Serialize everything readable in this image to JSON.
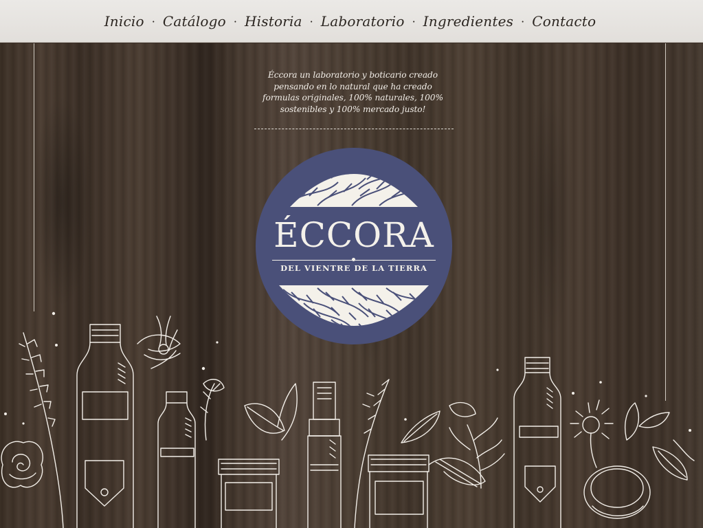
{
  "nav": {
    "items": [
      "Inicio",
      "Catálogo",
      "Historia",
      "Laboratorio",
      "Ingredientes",
      "Contacto"
    ],
    "separator": "·"
  },
  "hero": {
    "tagline_lines": [
      "Éccora un laboratorio y boticario creado",
      "pensando en  lo natural que ha creado",
      "formulas originales, 100% naturales, 100%",
      "sostenibles y  100%   mercado justo!"
    ]
  },
  "logo": {
    "name": "ÉCCORA",
    "subtitle": "DEL VIENTRE DE LA TIERRA"
  },
  "colors": {
    "nav_bg": "#e6e3df",
    "wood": "#45382e",
    "logo_bg": "#4a5079",
    "line_art": "#f2eee8"
  },
  "icons": [
    "leaf-pattern-icon",
    "bottle-icon",
    "jar-icon",
    "lavender-icon",
    "rose-icon",
    "spray-bottle-icon",
    "herb-icon"
  ]
}
